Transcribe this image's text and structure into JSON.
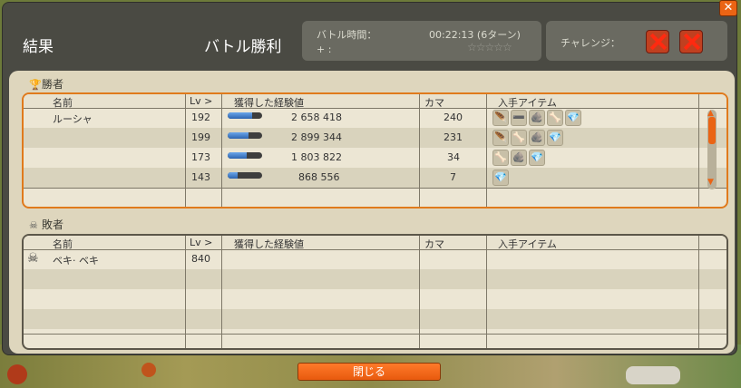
{
  "window": {
    "title": "結果",
    "subtitle": "バトル勝利",
    "close_icon": "✕"
  },
  "info": {
    "battle_time_label": "バトル時間：",
    "battle_time_value": "00:22:13 (6ターン)",
    "plus_label": "+ :",
    "stars": "☆☆☆☆☆"
  },
  "challenge": {
    "label": "チャレンジ：",
    "icons": [
      "failed-challenge-icon",
      "failed-challenge-icon"
    ]
  },
  "winners": {
    "label": "勝者",
    "icon": "trophy-icon",
    "headers": {
      "name": "名前",
      "lv": "Lv >",
      "xp": "獲得した経験値",
      "kama": "カマ",
      "items": "入手アイテム"
    },
    "rows": [
      {
        "name": "ルーシャ",
        "lv": "192",
        "xp": "2 658 418",
        "kama": "240",
        "xp_fill": 0.7,
        "items": [
          "🪶",
          "➖",
          "🪨",
          "🦴",
          "💎"
        ]
      },
      {
        "name": "",
        "lv": "199",
        "xp": "2 899 344",
        "kama": "231",
        "xp_fill": 0.6,
        "items": [
          "🪶",
          "🦴",
          "🪨",
          "💎"
        ]
      },
      {
        "name": "",
        "lv": "173",
        "xp": "1 803 822",
        "kama": "34",
        "xp_fill": 0.55,
        "items": [
          "🦴",
          "🪨",
          "💎"
        ]
      },
      {
        "name": "",
        "lv": "143",
        "xp": "868 556",
        "kama": "7",
        "xp_fill": 0.3,
        "items": [
          "💎"
        ]
      }
    ]
  },
  "losers": {
    "label": "敗者",
    "icon": "skull-icon",
    "headers": {
      "name": "名前",
      "lv": "Lv >",
      "xp": "獲得した経験値",
      "kama": "カマ",
      "items": "入手アイテム"
    },
    "rows": [
      {
        "name": "ベキ· ベキ",
        "lv": "840",
        "icon": "skull-icon"
      }
    ]
  },
  "footer": {
    "close_label": "閉じる"
  }
}
